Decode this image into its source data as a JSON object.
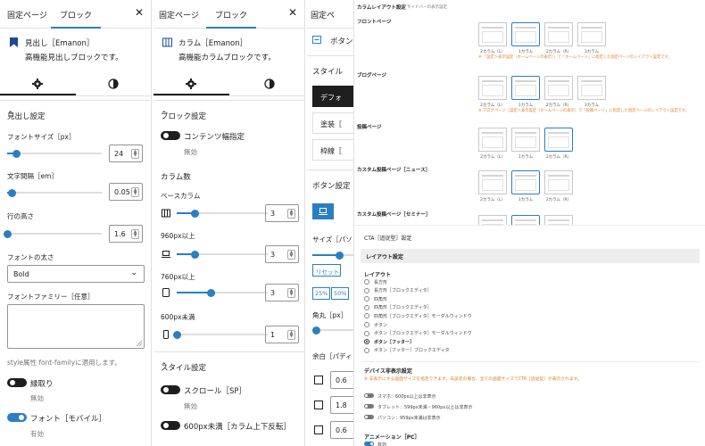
{
  "accent": "#2a7fc3",
  "panel1": {
    "tab_page": "固定ページ",
    "tab_block": "ブロック",
    "block_title": "見出し［Emanon］",
    "block_desc": "高機能見出しブロックです。",
    "section": "見出し設定",
    "font_size_label": "フォントサイズ［px］",
    "font_size_value": "24",
    "font_size_level": 0.1,
    "letter_spacing_label": "文字間隔［em］",
    "letter_spacing_value": "0.05",
    "letter_spacing_level": 0.05,
    "line_height_label": "行の高さ",
    "line_height_value": "1.6",
    "line_height_level": 0.0,
    "font_weight_label": "フォントの太さ",
    "font_weight_value": "Bold",
    "font_family_label": "フォントファミリー［任意］",
    "font_family_help": "style属性 font-familyに適用します。",
    "toggle1_label": "縁取り",
    "toggle1_status": "無効",
    "toggle2_label": "フォント［モバイル］",
    "toggle2_status": "有効"
  },
  "panel2": {
    "tab_page": "固定ページ",
    "tab_block": "ブロック",
    "block_title": "カラム［Emanon］",
    "block_desc": "高機能カラムブロックです。",
    "section": "ブロック設定",
    "toggle_content_label": "コンテンツ幅指定",
    "toggle_content_status": "無効",
    "columns_label": "カラム数",
    "base_label": "ベースカラム",
    "base_value": "3",
    "base_level": 0.2,
    "w960_label": "960px以上",
    "w960_value": "3",
    "w960_level": 0.2,
    "w760_label": "760px以上",
    "w760_value": "3",
    "w760_level": 0.38,
    "w600_label": "600px未満",
    "w600_value": "1",
    "w600_level": 0.0,
    "style_section": "スタイル設定",
    "scroll_label": "スクロール［SP］",
    "scroll_status": "無効",
    "reverse_label": "600px未満［カラム上下反転］"
  },
  "panel3": {
    "tab_page": "固定ペ",
    "block_label": "ボタン",
    "style_label": "スタイル",
    "btn_default": "デフォ",
    "btn_fill": "塗装［",
    "btn_outline": "枠線［",
    "section": "ボタン設定",
    "size_label": "サイズ［パソ",
    "reset_label": "リセット",
    "chip_25": "25%",
    "chip_50": "50%",
    "radius_label": "角丸［px］",
    "margin_label": "余白［パディ",
    "v1": "0.6",
    "v2": "1.8",
    "v3": "0.6"
  },
  "panel4": {
    "title": "カラムレイアウト設定",
    "subtitle": "サイドバーの表示設定",
    "groups": [
      {
        "label": "フロントページ",
        "captions": [
          "2カラム（L）",
          "1カラム",
          "2カラム（R）",
          "3カラム"
        ],
        "selected": 1,
        "note": "※ 「設定＞表示設定（ホームページの表示）」で「ホームページ」に指定した固定ページのレイアウト設定です。"
      },
      {
        "label": "ブログページ",
        "captions": [
          "2カラム（L）",
          "1カラム",
          "2カラム（R）",
          "3カラム"
        ],
        "selected": 1,
        "note": "※ ブログページ（設定＞表示設定（ホームページの表示）で「投稿ページ」に指定した固定ページのレイアウト設定です。"
      },
      {
        "label": "投稿ページ",
        "captions": [
          "2カラム（L）",
          "1カラム",
          "2カラム（R）"
        ],
        "selected": 2,
        "note": ""
      },
      {
        "label": "カスタム投稿ページ［ニュース］",
        "captions": [
          "2カラム（L）",
          "1カラム",
          "2カラム（R）"
        ],
        "selected": 1,
        "note": ""
      },
      {
        "label": "カスタム投稿ページ［セミナー］",
        "captions": [],
        "selected": 1,
        "note": ""
      }
    ]
  },
  "panel5": {
    "title": "CTA［追従型］設定",
    "head": "レイアウト設定",
    "layout_label": "レイアウト",
    "options": [
      "長方形",
      "長方形［ブロックエディタ］",
      "四角形",
      "四角形［ブロックエディタ］",
      "四角形［ブロックエディタ］モーダルウィンドウ",
      "ボタン",
      "ボタン［ブロックエディタ］モーダルウィンドウ",
      "ボタン［フッター］",
      "ボタン［フッター］ブロックエディタ"
    ],
    "selected": 7,
    "device_label": "デバイス非表示設定",
    "device_warn": "※ 非表示にする画面サイズを指定できます。未設定の場合、全ての画面サイズでCTA［追従型］が表示されます。",
    "devices": [
      "スマホ：600px以上は非表示",
      "タブレット：599px未満・960px以上は非表示",
      "パソコン：959px未満は非表示"
    ],
    "anim_label": "アニメーション［PC］",
    "anim_status": "有効"
  }
}
